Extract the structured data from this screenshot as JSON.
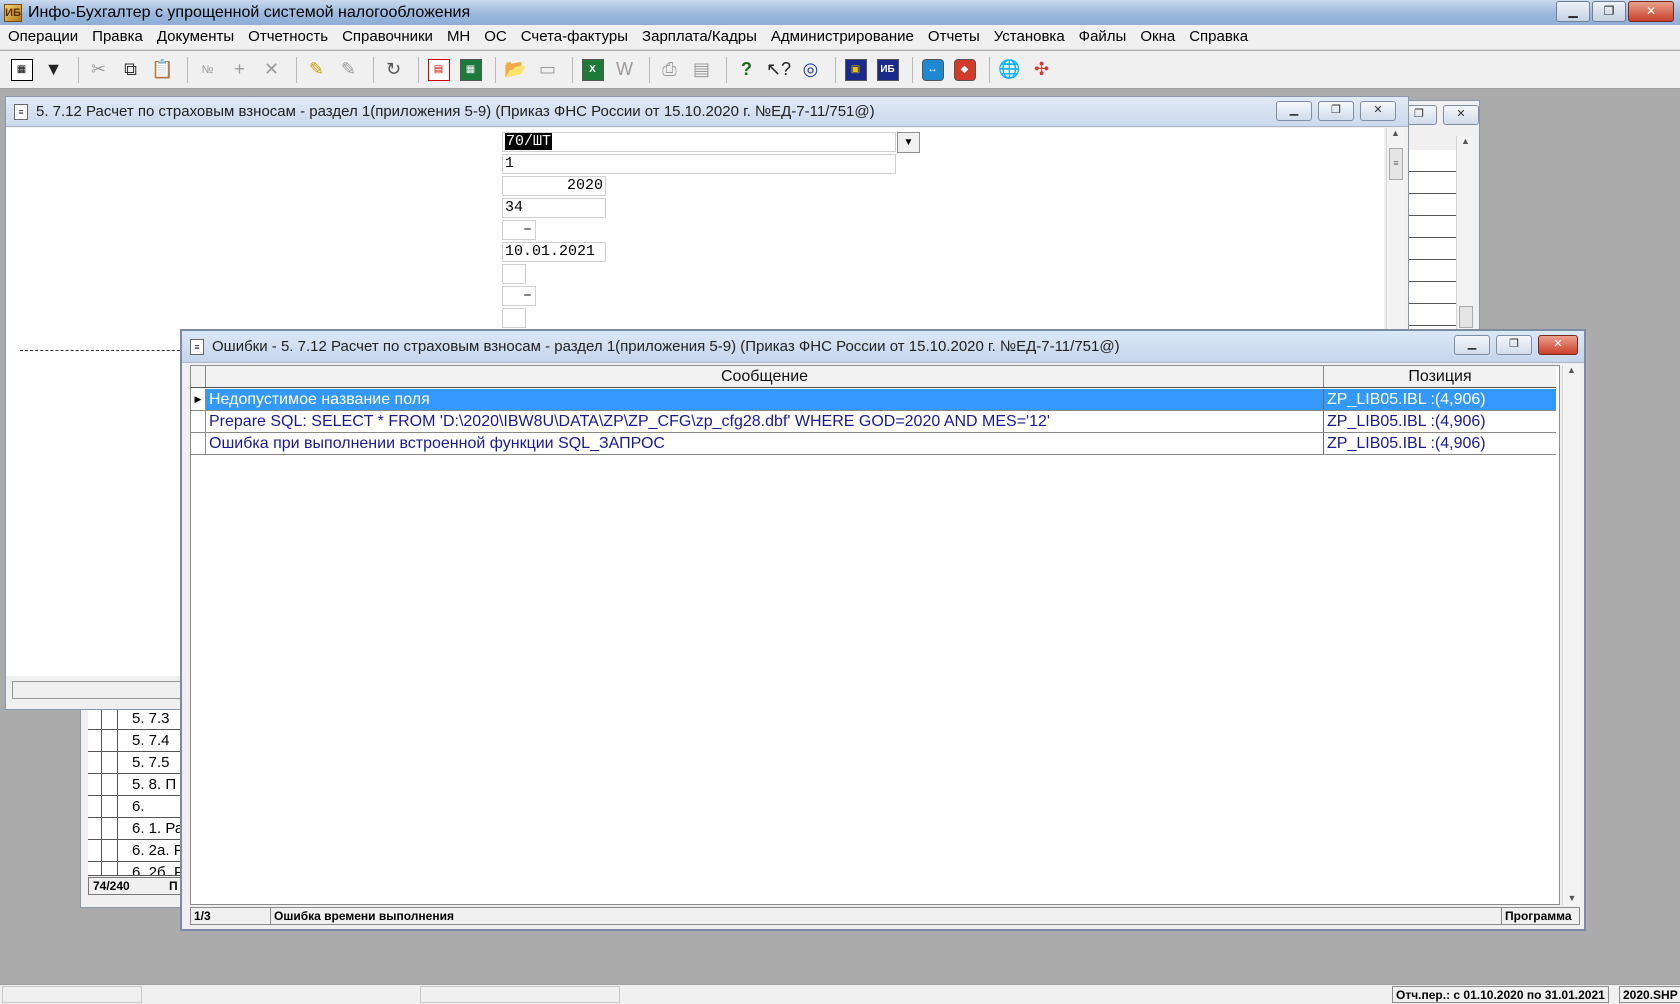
{
  "app": {
    "title": "Инфо-Бухгалтер с упрощенной системой налогообложения"
  },
  "menu": [
    "Операции",
    "Правка",
    "Документы",
    "Отчетность",
    "Справочники",
    "МН",
    "ОС",
    "Счета-фактуры",
    "Зарплата/Кадры",
    "Администрирование",
    "Отчеты",
    "Установка",
    "Файлы",
    "Окна",
    "Справка"
  ],
  "toolbar_icons": [
    "grid-icon",
    "filter-icon",
    "cut-icon",
    "copy-icon",
    "paste-icon",
    "numbering-icon",
    "add-icon",
    "delete-icon",
    "mark-icon",
    "unmark-icon",
    "refresh-icon",
    "report-icon",
    "calculator-icon",
    "open-folder-icon",
    "save-icon",
    "excel-icon",
    "word-icon",
    "print-icon",
    "preview-icon",
    "help-icon",
    "context-help-icon",
    "navigator-icon",
    "book-icon",
    "info-icon",
    "teamviewer-icon",
    "remote-icon",
    "web-icon",
    "network-icon"
  ],
  "form_window": {
    "title": "5.  7.12 Расчет по страховым взносам - раздел 1(приложения 5-9) (Приказ ФНС России от 15.10.2020 г. №ЕД-7-11/751@)",
    "fields": {
      "unit": "70/ШТ",
      "f1": "1",
      "year": "2020",
      "f34": "34",
      "dash1": "–",
      "date": "10.01.2021",
      "dash2": "–"
    }
  },
  "back_list": {
    "rows": [
      "5.  7.3",
      "5.  7.4",
      "5.  7.5",
      "5.  8. П",
      "6.",
      "6. 1. Ра",
      "6. 2а. Р",
      "6. 2б. Р"
    ],
    "counter": "74/240",
    "counter_right": "П"
  },
  "error_window": {
    "title": "Ошибки - 5.  7.12 Расчет по страховым взносам - раздел 1(приложения 5-9) (Приказ ФНС России от 15.10.2020 г. №ЕД-7-11/751@)",
    "columns": {
      "message": "Сообщение",
      "position": "Позиция"
    },
    "rows": [
      {
        "message": "Недопустимое название поля",
        "position": "ZP_LIB05.IBL :(4,906)"
      },
      {
        "message": "Prepare SQL: SELECT * FROM 'D:\\2020\\IBW8U\\DATA\\ZP\\ZP_CFG\\zp_cfg28.dbf' WHERE GOD=2020 AND MES='12'",
        "position": "ZP_LIB05.IBL :(4,906)"
      },
      {
        "message": "Ошибка при выполнении встроенной функции SQL_ЗАПРОС",
        "position": "ZP_LIB05.IBL :(4,906)"
      }
    ],
    "status": {
      "counter": "1/3",
      "message": "Ошибка времени выполнения",
      "source": "Программа"
    }
  },
  "statusbar": {
    "period": "Отч.пер.: с 01.10.2020 по 31.01.2021",
    "file": "2020.SHP"
  }
}
